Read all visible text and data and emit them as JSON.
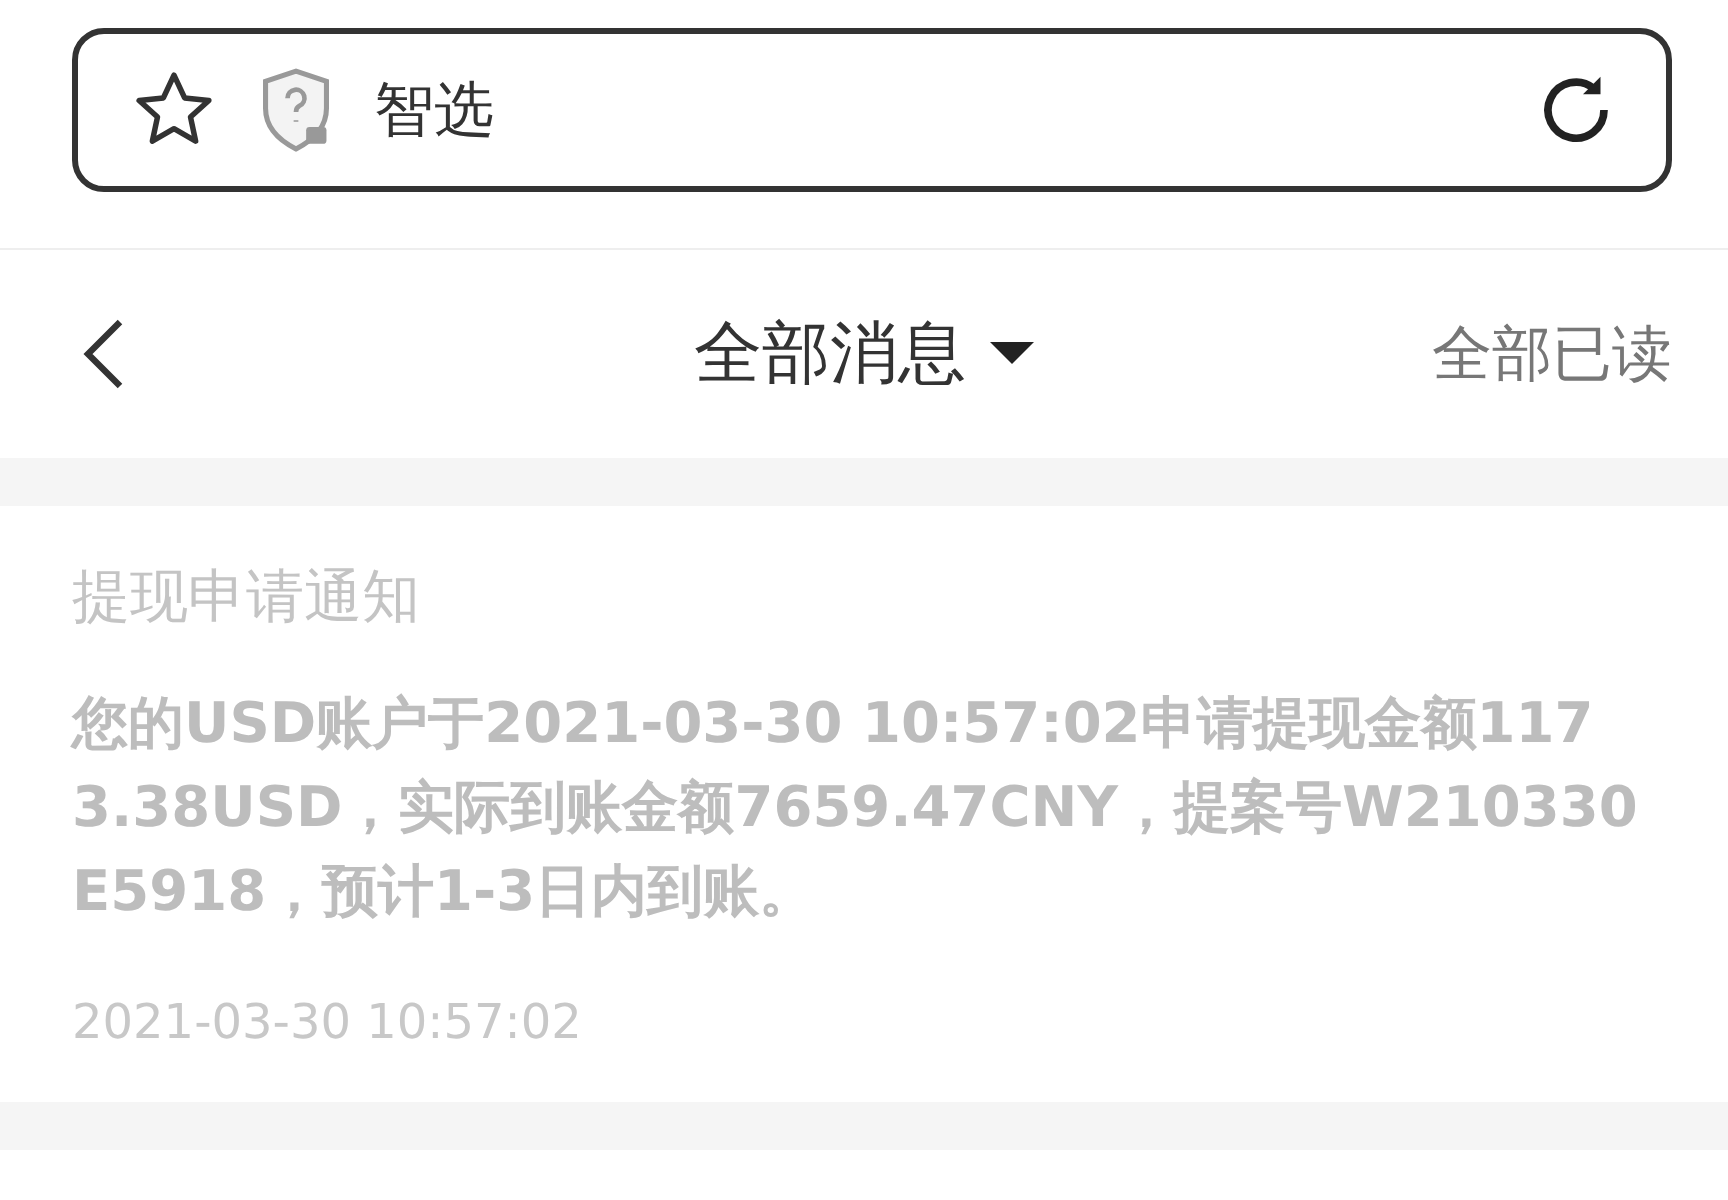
{
  "address_bar": {
    "site_name": "智选"
  },
  "header": {
    "title": "全部消息",
    "action": "全部已读"
  },
  "messages": [
    {
      "title": "提现申请通知",
      "body": "您的USD账户于2021-03-30 10:57:02申请提现金额1173.38USD，实际到账金额7659.47CNY，提案号W210330E5918，预计1-3日内到账。",
      "time": "2021-03-30 10:57:02",
      "read": true
    }
  ]
}
